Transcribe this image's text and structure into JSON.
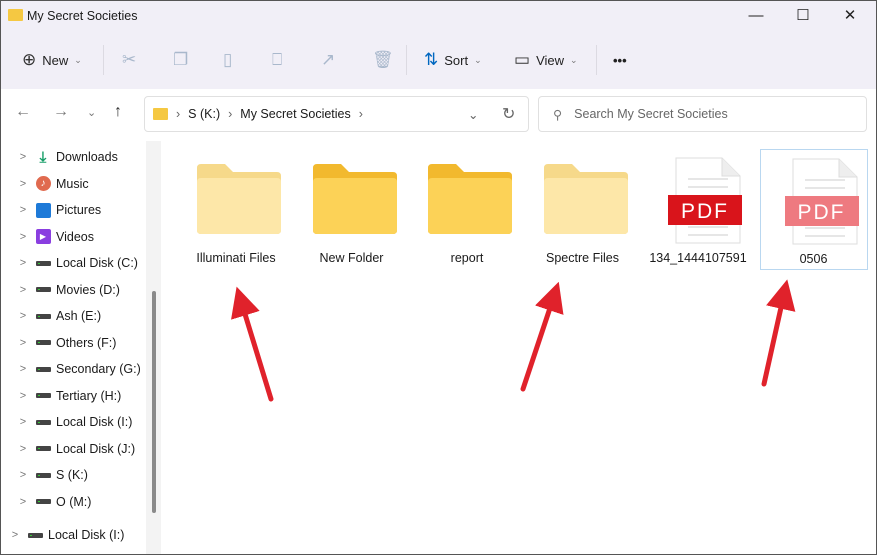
{
  "window": {
    "title": "My Secret Societies",
    "minimize": "—",
    "maximize": "☐",
    "close": "✕"
  },
  "toolbar": {
    "new_label": "New",
    "sort_label": "Sort",
    "view_label": "View",
    "more": "•••"
  },
  "nav": {
    "breadcrumb": [
      "S (K:)",
      "My Secret Societies"
    ],
    "search_placeholder": "Search My Secret Societies"
  },
  "sidebar": {
    "items": [
      {
        "label": "Downloads",
        "icon": "download"
      },
      {
        "label": "Music",
        "icon": "music"
      },
      {
        "label": "Pictures",
        "icon": "pictures"
      },
      {
        "label": "Videos",
        "icon": "videos"
      },
      {
        "label": "Local Disk (C:)",
        "icon": "drive-windows"
      },
      {
        "label": "Movies (D:)",
        "icon": "drive"
      },
      {
        "label": "Ash (E:)",
        "icon": "drive"
      },
      {
        "label": "Others (F:)",
        "icon": "drive"
      },
      {
        "label": "Secondary (G:)",
        "icon": "drive"
      },
      {
        "label": "Tertiary (H:)",
        "icon": "drive"
      },
      {
        "label": "Local Disk (I:)",
        "icon": "drive"
      },
      {
        "label": "Local Disk (J:)",
        "icon": "drive"
      },
      {
        "label": "S (K:)",
        "icon": "drive"
      },
      {
        "label": "O (M:)",
        "icon": "drive"
      },
      {
        "label": "Local Disk (I:)",
        "icon": "drive"
      }
    ]
  },
  "files": [
    {
      "name": "Illuminati Files",
      "type": "folder-light"
    },
    {
      "name": "New Folder",
      "type": "folder"
    },
    {
      "name": "report",
      "type": "folder"
    },
    {
      "name": "Spectre Files",
      "type": "folder-light"
    },
    {
      "name": "134_1444107591",
      "type": "pdf",
      "badge": "PDF"
    },
    {
      "name": "0506",
      "type": "pdf-selected",
      "badge": "PDF"
    }
  ],
  "colors": {
    "accent": "#0067c0",
    "pdf_red": "#d9141b",
    "arrow_red": "#e0222b"
  }
}
